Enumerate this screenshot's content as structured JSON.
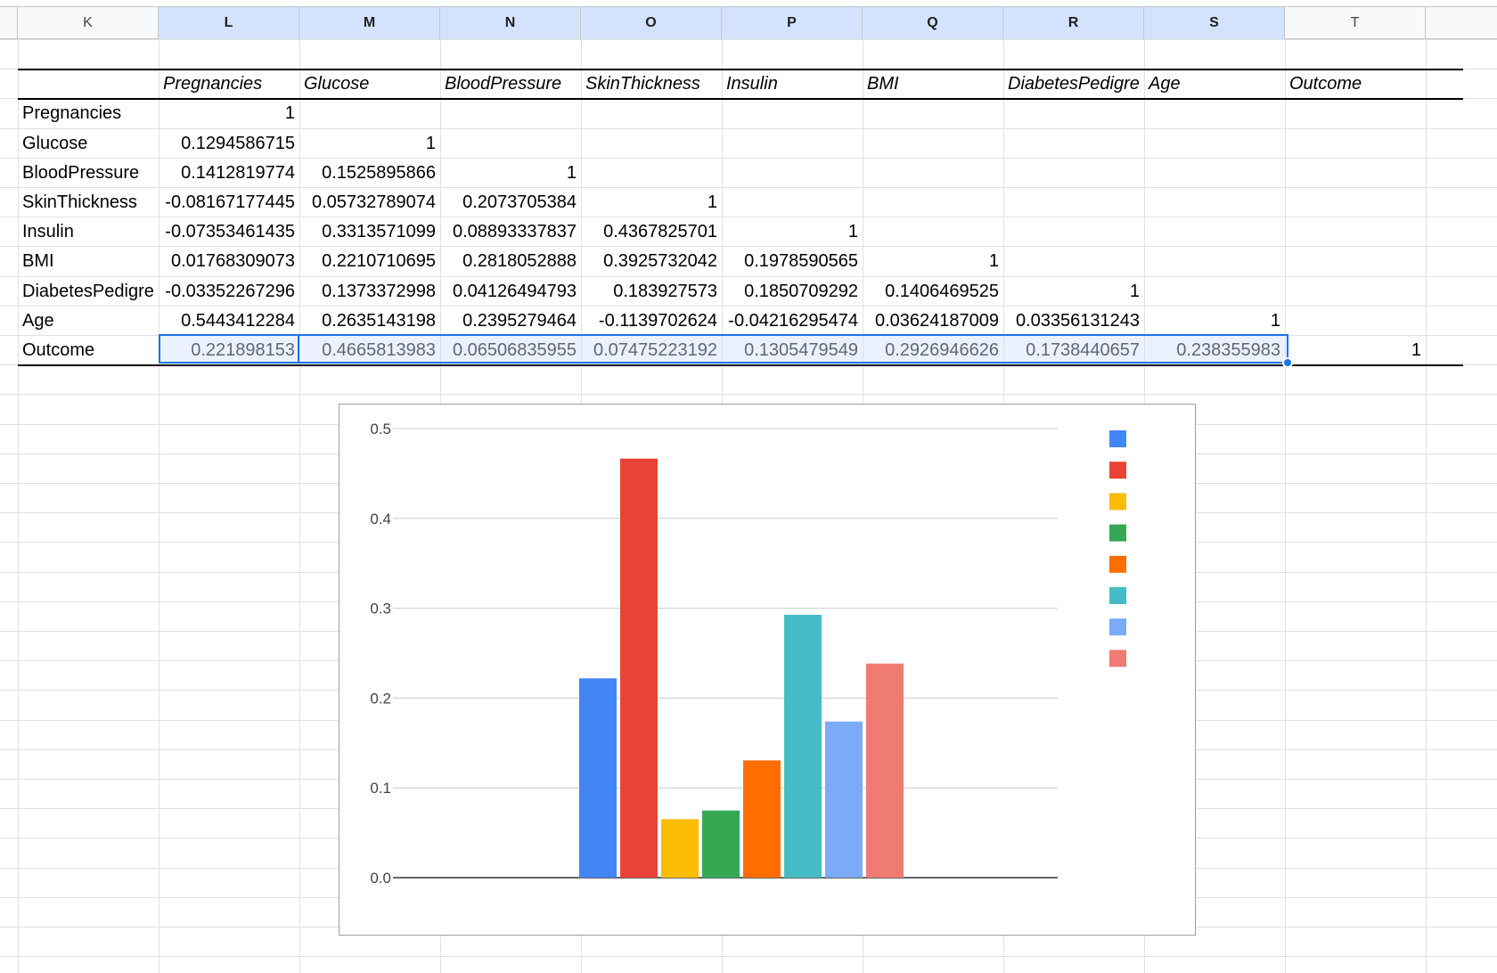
{
  "columns": [
    "K",
    "L",
    "M",
    "N",
    "O",
    "P",
    "Q",
    "R",
    "S",
    "T"
  ],
  "table": {
    "headers": [
      "Pregnancies",
      "Glucose",
      "BloodPressure",
      "SkinThickness",
      "Insulin",
      "BMI",
      "DiabetesPedigre",
      "Age",
      "Outcome"
    ],
    "rows": [
      {
        "label": "Pregnancies",
        "values": [
          "1"
        ]
      },
      {
        "label": "Glucose",
        "values": [
          "0.1294586715",
          "1"
        ]
      },
      {
        "label": "BloodPressure",
        "values": [
          "0.1412819774",
          "0.1525895866",
          "1"
        ]
      },
      {
        "label": "SkinThickness",
        "values": [
          "-0.08167177445",
          "0.05732789074",
          "0.2073705384",
          "1"
        ]
      },
      {
        "label": "Insulin",
        "values": [
          "-0.07353461435",
          "0.3313571099",
          "0.08893337837",
          "0.4367825701",
          "1"
        ]
      },
      {
        "label": "BMI",
        "values": [
          "0.01768309073",
          "0.2210710695",
          "0.2818052888",
          "0.3925732042",
          "0.1978590565",
          "1"
        ]
      },
      {
        "label": "DiabetesPedigre",
        "values": [
          "-0.03352267296",
          "0.1373372998",
          "0.04126494793",
          "0.183927573",
          "0.1850709292",
          "0.1406469525",
          "1"
        ]
      },
      {
        "label": "Age",
        "values": [
          "0.5443412284",
          "0.2635143198",
          "0.2395279464",
          "-0.1139702624",
          "-0.04216295474",
          "0.03624187009",
          "0.03356131243",
          "1"
        ]
      },
      {
        "label": "Outcome",
        "values": [
          "0.221898153",
          "0.4665813983",
          "0.06506835955",
          "0.07475223192",
          "0.1305479549",
          "0.2926946626",
          "0.1738440657",
          "0.238355983",
          "1"
        ]
      }
    ]
  },
  "chart_data": {
    "type": "bar",
    "title": "",
    "xlabel": "",
    "ylabel": "",
    "ylim": [
      0,
      0.5
    ],
    "yticks": [
      "0.0",
      "0.1",
      "0.2",
      "0.3",
      "0.4",
      "0.5"
    ],
    "grid": true,
    "legend_position": "right",
    "series": [
      {
        "color": "#4285f4",
        "values": [
          0.221898153
        ]
      },
      {
        "color": "#ea4335",
        "values": [
          0.4665813983
        ]
      },
      {
        "color": "#fbbc04",
        "values": [
          0.06506835955
        ]
      },
      {
        "color": "#34a853",
        "values": [
          0.07475223192
        ]
      },
      {
        "color": "#ff6d01",
        "values": [
          0.1305479549
        ]
      },
      {
        "color": "#46bdc6",
        "values": [
          0.2926946626
        ]
      },
      {
        "color": "#7baaf7",
        "values": [
          0.1738440657
        ]
      },
      {
        "color": "#f07b72",
        "values": [
          0.238355983
        ]
      }
    ]
  }
}
